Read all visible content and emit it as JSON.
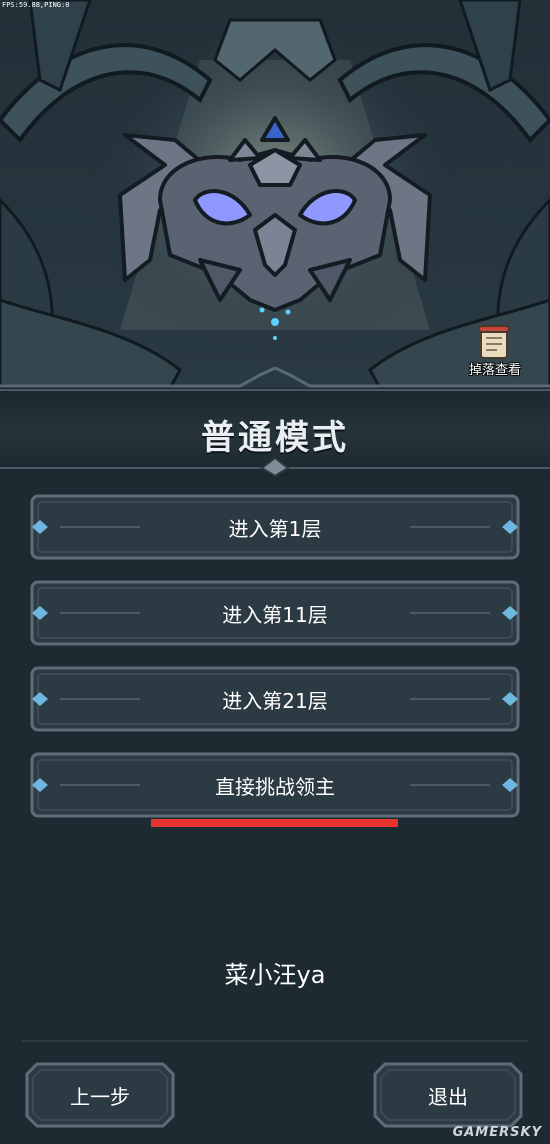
{
  "hud": {
    "fps_text": "FPS:59.88,PING:0"
  },
  "scene": {
    "loot_label": "掉落查看"
  },
  "mode_title": "普通模式",
  "floor_options": [
    {
      "label": "进入第1层"
    },
    {
      "label": "进入第11层"
    },
    {
      "label": "进入第21层"
    },
    {
      "label": "直接挑战领主"
    }
  ],
  "overlay": {
    "watermark_text": "菜小汪ya",
    "site_mark": "GAMERSKY"
  },
  "footer": {
    "back_label": "上一步",
    "exit_label": "退出"
  },
  "colors": {
    "background": "#1e2a31",
    "button_fill": "#2c3a43",
    "button_border": "#5d6d77",
    "highlight_underline": "#e8342e",
    "boss_eyes": "#8e98ff"
  }
}
